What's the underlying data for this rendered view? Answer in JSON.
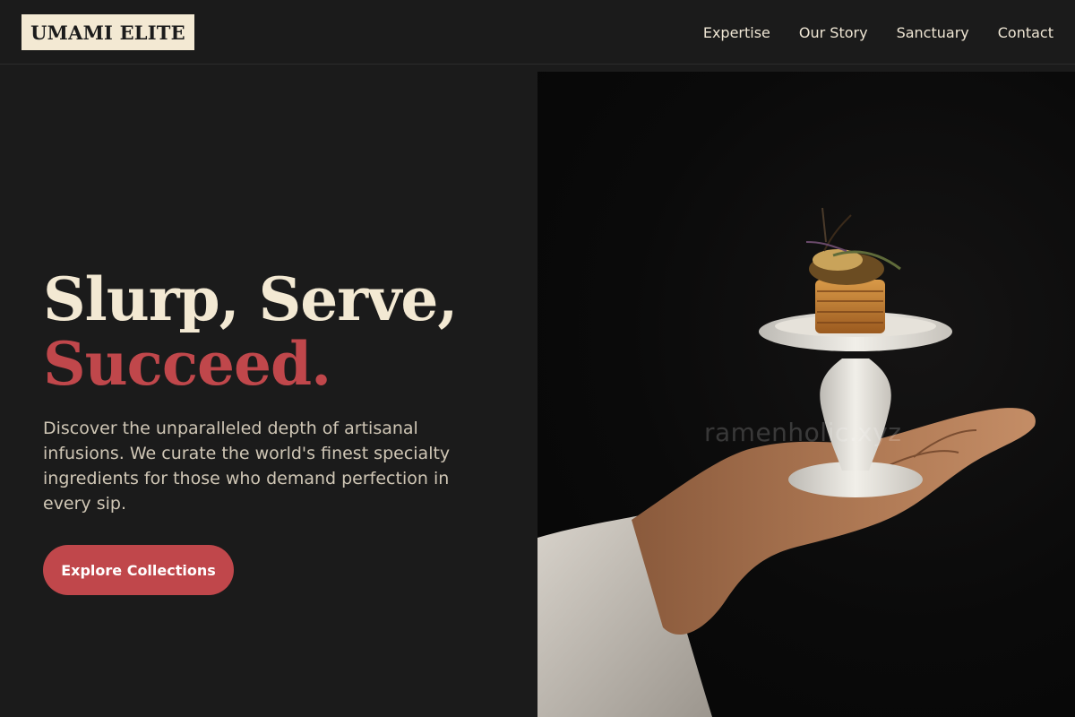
{
  "brand": {
    "logo_text": "UMAMI ELITE"
  },
  "nav": {
    "items": [
      {
        "label": "Expertise"
      },
      {
        "label": "Our Story"
      },
      {
        "label": "Sanctuary"
      },
      {
        "label": "Contact"
      }
    ]
  },
  "hero": {
    "headline_line1": "Slurp, Serve,",
    "headline_line2": "Succeed.",
    "description": "Discover the unparalleled depth of artisanal infusions. We curate the world's finest specialty ingredients for those who demand perfection in every sip.",
    "cta_label": "Explore Collections",
    "watermark": "ramenholic.xyz"
  },
  "colors": {
    "background": "#1b1b1b",
    "cream": "#f3e9d3",
    "accent_red": "#c0474b"
  }
}
